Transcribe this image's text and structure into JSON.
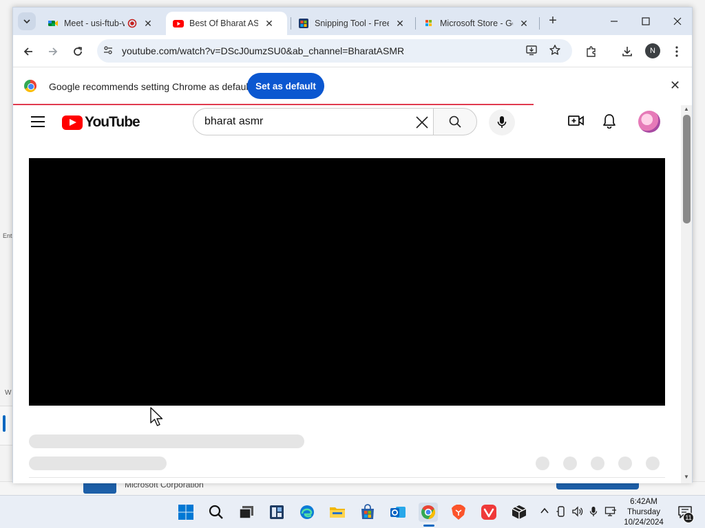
{
  "background_app": {
    "left_text": "Ent",
    "left_letter": "W",
    "publisher": "Microsoft Corporation"
  },
  "browser": {
    "tabs": [
      {
        "title": "Meet - usi-ftub-v",
        "favicon": "google-meet-icon",
        "recording": true,
        "active": false
      },
      {
        "title": "Best Of Bharat ASMR",
        "favicon": "youtube-icon",
        "active": true
      },
      {
        "title": "Snipping Tool - Free",
        "favicon": "microsoft-store-icon",
        "active": false
      },
      {
        "title": "Microsoft Store - Ge",
        "favicon": "bing-icon",
        "active": false
      }
    ],
    "new_tab_label": "+",
    "url": "youtube.com/watch?v=DScJ0umzSU0&ab_channel=BharatASMR",
    "profile_initial": "N",
    "infobar": {
      "message": "Google recommends setting Chrome as default",
      "button_label": "Set as default"
    }
  },
  "youtube": {
    "logo_text": "YouTube",
    "search_query": "bharat asmr"
  },
  "taskbar": {
    "apps": [
      "windows-start-icon",
      "search-icon",
      "task-view-icon",
      "widgets-icon",
      "edge-icon",
      "file-explorer-icon",
      "microsoft-store-icon",
      "outlook-icon",
      "chrome-icon",
      "brave-icon",
      "vivaldi-icon",
      "package-icon"
    ],
    "active_app": "chrome-icon",
    "clock": {
      "time": "6:42AM",
      "day": "Thursday",
      "date": "10/24/2024"
    },
    "notification_count": "11"
  },
  "colors": {
    "accent": "#0b57d0",
    "youtube_red": "#ff0000",
    "load_bar": "#e03a4e",
    "taskbar_active": "#0067c0"
  }
}
